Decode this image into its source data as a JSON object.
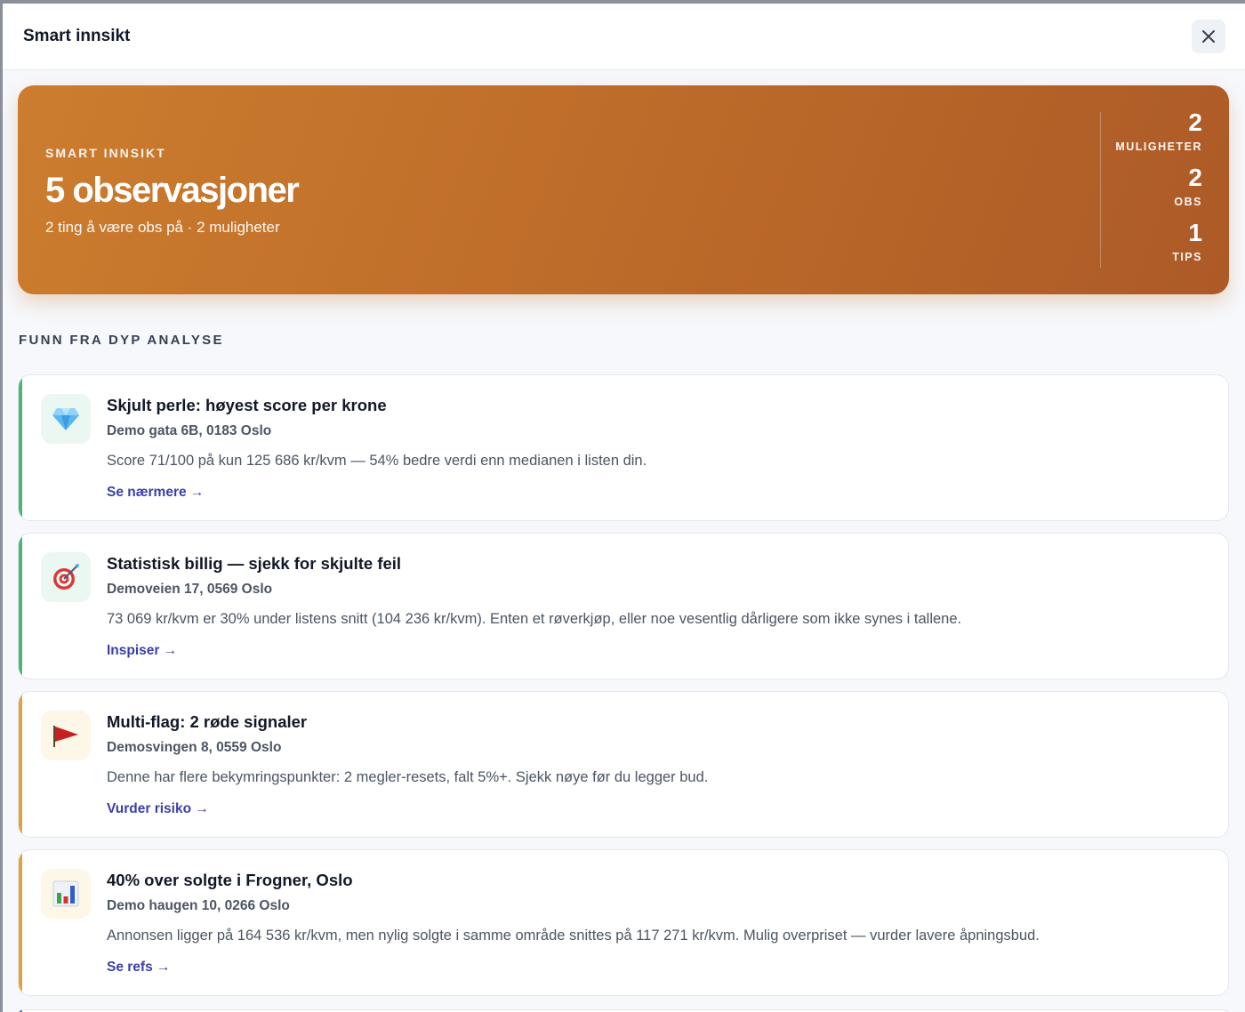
{
  "header": {
    "title": "Smart innsikt"
  },
  "hero": {
    "eyebrow": "SMART INNSIKT",
    "count_text": "5 observasjoner",
    "subtitle": "2 ting å være obs på · 2 muligheter",
    "stats": [
      {
        "value": "2",
        "label": "MULIGHETER"
      },
      {
        "value": "2",
        "label": "OBS"
      },
      {
        "value": "1",
        "label": "TIPS"
      }
    ]
  },
  "section": {
    "title": "FUNN FRA DYP ANALYSE"
  },
  "colors": {
    "accent_green": "#4bb47a",
    "accent_orange": "#e0a23f",
    "link": "#3b3fa8",
    "hero_start": "#cc7d2e",
    "hero_end": "#ad5a27"
  },
  "cards": [
    {
      "icon": "diamond-icon",
      "title": "Skjult perle: høyest score per krone",
      "address": "Demo gata 6B, 0183 Oslo",
      "description": "Score 71/100 på kun 125 686 kr/kvm — 54% bedre verdi enn medianen i listen din.",
      "link": "Se nærmere →"
    },
    {
      "icon": "target-icon",
      "title": "Statistisk billig — sjekk for skjulte feil",
      "address": "Demoveien 17, 0569 Oslo",
      "description": "73 069 kr/kvm er 30% under listens snitt (104 236 kr/kvm). Enten et røverkjøp, eller noe vesentlig dårligere som ikke synes i tallene.",
      "link": "Inspiser →"
    },
    {
      "icon": "red-flag-icon",
      "title": "Multi-flag: 2 røde signaler",
      "address": "Demosvingen 8, 0559 Oslo",
      "description": "Denne har flere bekymringspunkter: 2 megler-resets, falt 5%+. Sjekk nøye før du legger bud.",
      "link": "Vurder risiko →"
    },
    {
      "icon": "bar-chart-icon",
      "title": "40% over solgte i Frogner, Oslo",
      "address": "Demo haugen 10, 0266 Oslo",
      "description": "Annonsen ligger på 164 536 kr/kvm, men nylig solgte i samme område snittes på 117 271 kr/kvm. Mulig overpriset — vurder lavere åpningsbud.",
      "link": "Se refs →"
    }
  ]
}
